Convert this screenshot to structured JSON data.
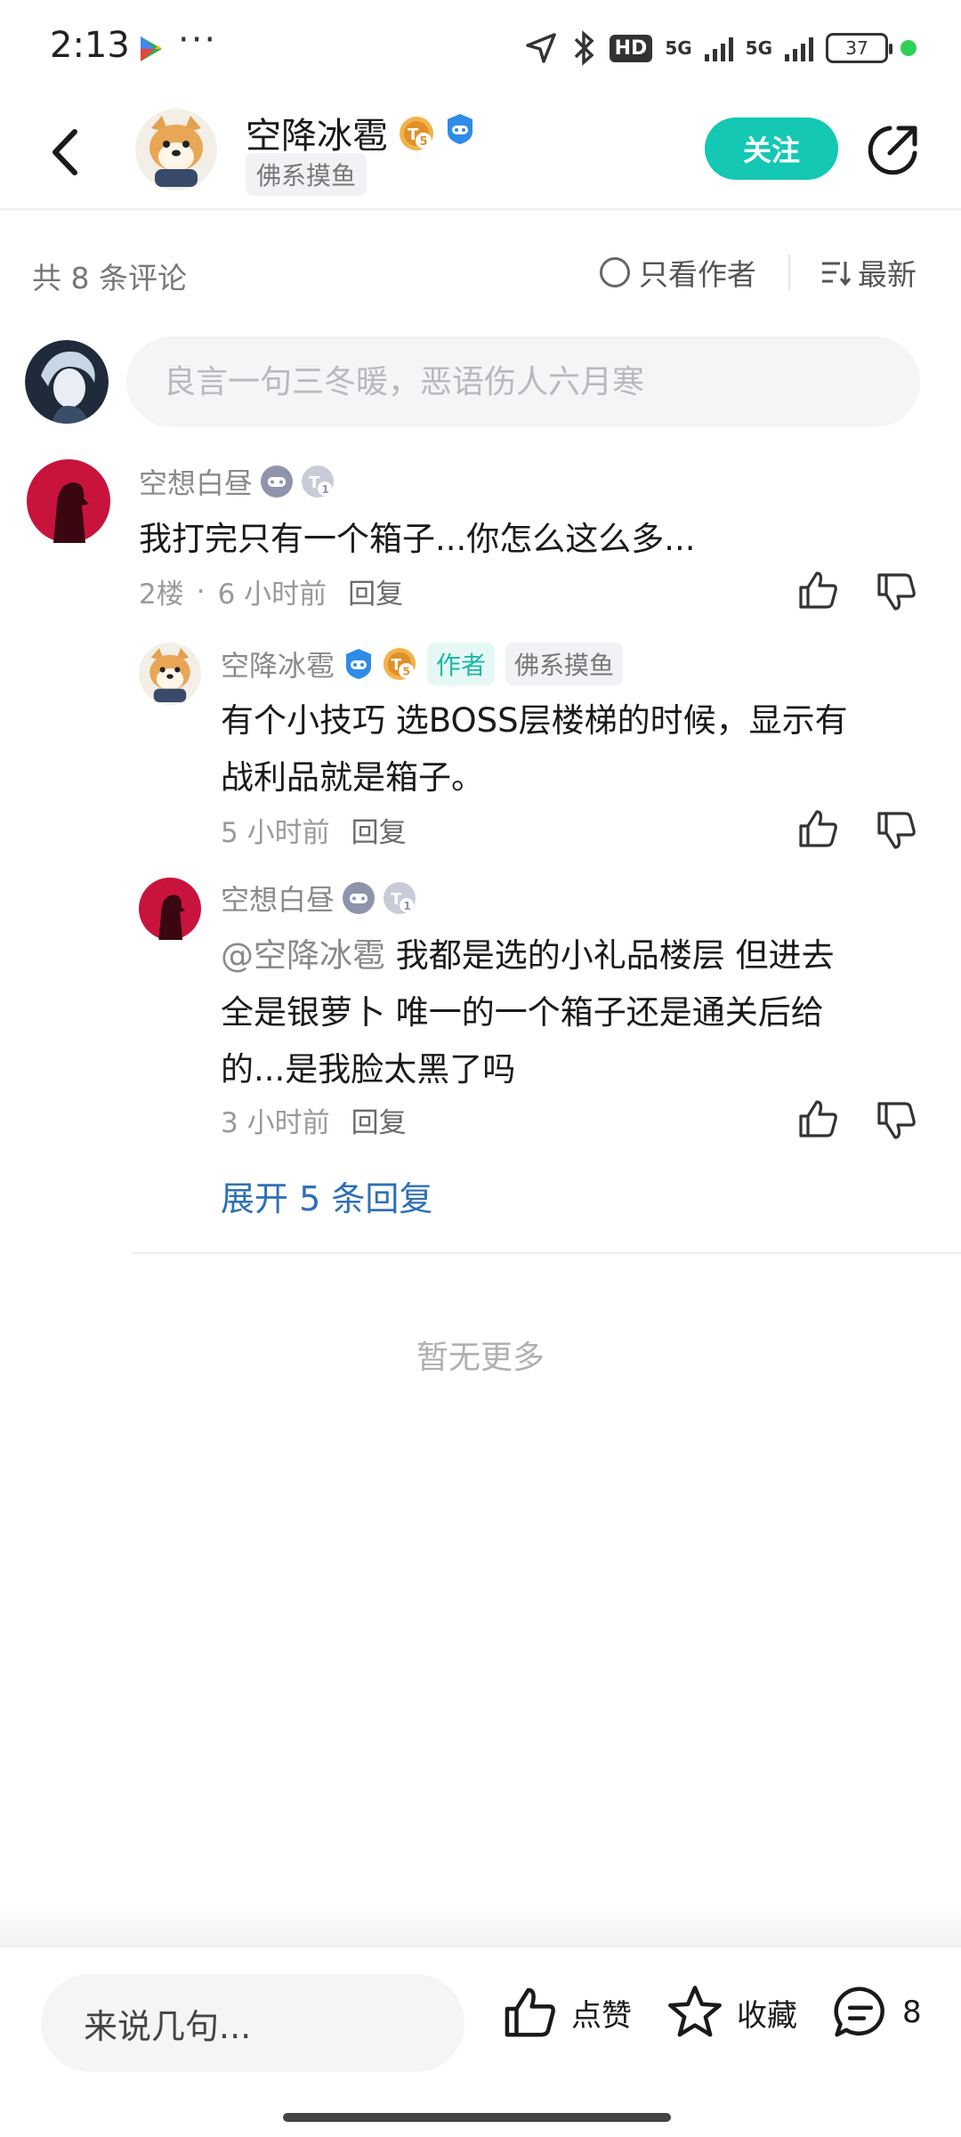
{
  "status_bar": {
    "time": "2:13",
    "dots": "···",
    "hd": "HD",
    "net1": "5G",
    "net2": "5G",
    "battery": "37"
  },
  "header": {
    "author_name": "空降冰雹",
    "author_tag": "佛系摸鱼",
    "follow_label": "关注"
  },
  "filter": {
    "count_label": "共 8 条评论",
    "only_author_label": "只看作者",
    "sort_label": "最新"
  },
  "comment_input": {
    "placeholder": "良言一句三冬暖，恶语伤人六月寒"
  },
  "comments": [
    {
      "username": "空想白昼",
      "text": "我打完只有一个箱子...你怎么这么多...",
      "floor": "2楼",
      "sep": "·",
      "time": "6 小时前",
      "reply": "回复"
    },
    {
      "username": "空降冰雹",
      "author_pill": "作者",
      "tag": "佛系摸鱼",
      "text_line1": "有个小技巧 选BOSS层楼梯的时候，显示有",
      "text_line2": "战利品就是箱子。",
      "time": "5 小时前",
      "reply": "回复"
    },
    {
      "username": "空想白昼",
      "mention": "@空降冰雹",
      "text_line1": " 我都是选的小礼品楼层  但进去",
      "text_line2": "全是银萝卜  唯一的一个箱子还是通关后给",
      "text_line3": "的...是我脸太黑了吗",
      "time": "3 小时前",
      "reply": "回复"
    }
  ],
  "expand_label": "展开 5 条回复",
  "no_more_label": "暂无更多",
  "bottom_bar": {
    "say_placeholder": "来说几句...",
    "like_label": "点赞",
    "favorite_label": "收藏",
    "comment_count": "8"
  },
  "colors": {
    "accent": "#14c8b3",
    "link": "#2f70b5"
  }
}
